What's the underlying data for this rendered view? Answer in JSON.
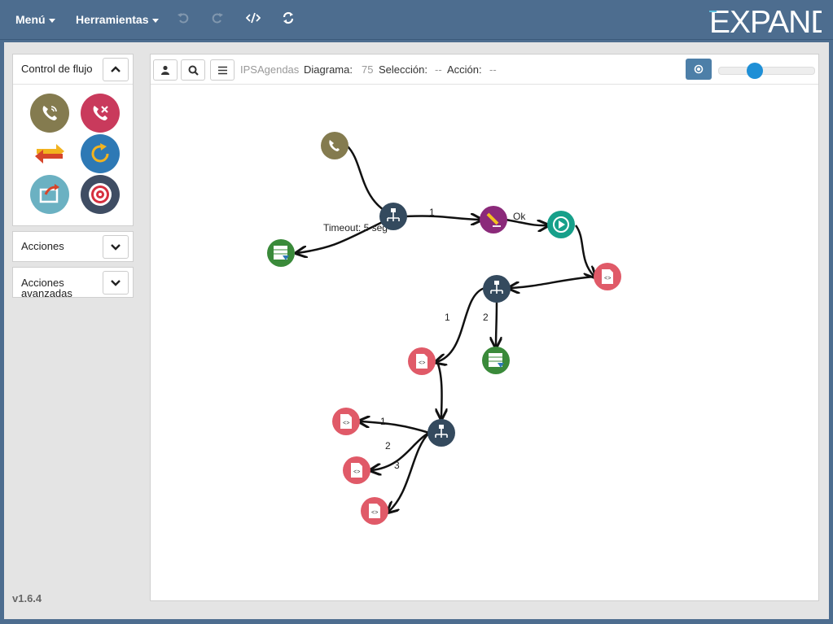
{
  "header": {
    "menu_label": "Menú",
    "tools_label": "Herramientas",
    "logo_text": "EXPAND",
    "icons": [
      "undo-icon",
      "redo-icon",
      "code-icon",
      "refresh-icon"
    ]
  },
  "sidebar": {
    "panels": [
      {
        "title": "Control de flujo",
        "expanded": true,
        "toggle_icon": "chevron-up-icon"
      },
      {
        "title": "Acciones",
        "expanded": false,
        "toggle_icon": "chevron-down-icon"
      },
      {
        "title": "Acciones avanzadas",
        "expanded": false,
        "toggle_icon": "chevron-down-icon"
      }
    ],
    "tools": [
      {
        "icon": "phone-call-icon",
        "color": "#847b4f"
      },
      {
        "icon": "phone-hangup-icon",
        "color": "#c93a5c"
      },
      {
        "icon": "transfer-arrows-icon",
        "color": "#f2b31f"
      },
      {
        "icon": "loop-icon",
        "color": "#2e79b5"
      },
      {
        "icon": "redirect-icon",
        "color": "#6bb1c2"
      },
      {
        "icon": "target-icon",
        "color": "#3f4d63"
      }
    ],
    "version": "v1.6.4"
  },
  "canvas": {
    "toolbar": {
      "user_icon": "user-icon",
      "search_icon": "search-icon",
      "menu_icon": "hamburger-icon",
      "project_name": "IPSAgendas",
      "diagram_label": "Diagrama:",
      "diagram_value": "75",
      "selection_label": "Selección:",
      "selection_value": "--",
      "action_label": "Acción:",
      "action_value": "--",
      "center_icon": "target-circle-icon",
      "zoom_level": 0.35
    },
    "edge_labels": {
      "a": "1",
      "b": "Ok",
      "c": "Timeout: 5 seg",
      "d": "1",
      "e": "2",
      "f": "1",
      "g": "2",
      "h": "3"
    },
    "colors": {
      "phone": "#847b4f",
      "switch": "#344a5e",
      "edit": "#8b2a7a",
      "play": "#17a08a",
      "script": "#e05a68",
      "db": "#3a8a3a",
      "edge": "#111111"
    }
  }
}
